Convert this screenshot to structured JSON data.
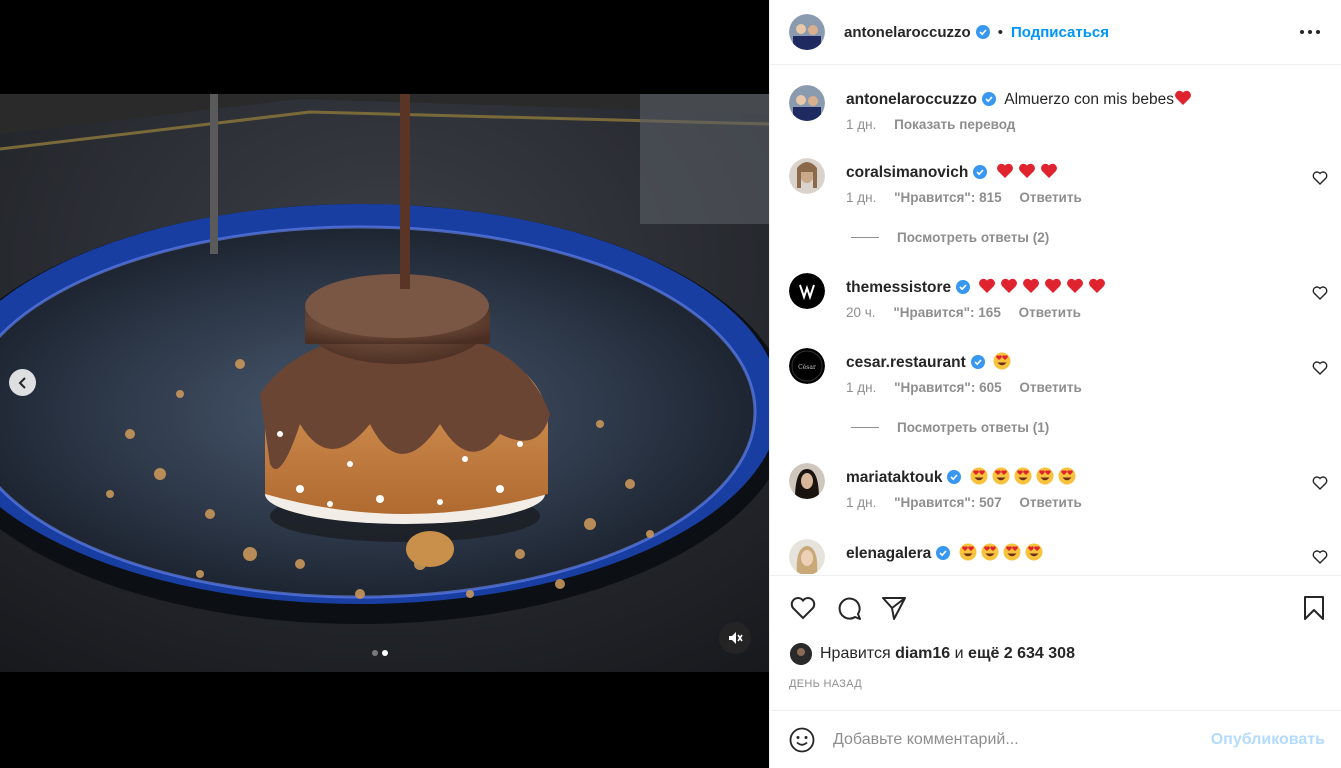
{
  "post": {
    "author": "antonelaroccuzzo",
    "follow_label": "Подписаться",
    "separator": "•",
    "caption": "Almuerzo con mis bebes",
    "caption_time": "1 дн.",
    "translate_label": "Показать перевод"
  },
  "comments": [
    {
      "user": "coralsimanovich",
      "emoji": [
        "heart",
        "heart",
        "heart"
      ],
      "time": "1 дн.",
      "likes": "\"Нравится\": 815",
      "reply": "Ответить",
      "replies_label": "Посмотреть ответы (2)"
    },
    {
      "user": "themessistore",
      "emoji": [
        "heart",
        "heart",
        "heart",
        "heart",
        "heart",
        "heart"
      ],
      "time": "20 ч.",
      "likes": "\"Нравится\": 165",
      "reply": "Ответить",
      "replies_label": ""
    },
    {
      "user": "cesar.restaurant",
      "emoji": [
        "heart-eyes"
      ],
      "time": "1 дн.",
      "likes": "\"Нравится\": 605",
      "reply": "Ответить",
      "replies_label": "Посмотреть ответы (1)"
    },
    {
      "user": "mariataktouk",
      "emoji": [
        "heart-eyes",
        "heart-eyes",
        "heart-eyes",
        "heart-eyes",
        "heart-eyes"
      ],
      "time": "1 дн.",
      "likes": "\"Нравится\": 507",
      "reply": "Ответить",
      "replies_label": ""
    },
    {
      "user": "elenagalera",
      "emoji": [
        "heart-eyes",
        "heart-eyes",
        "heart-eyes",
        "heart-eyes"
      ],
      "time": "",
      "likes": "",
      "reply": "",
      "replies_label": ""
    }
  ],
  "likes": {
    "prefix": "Нравится",
    "user": "diam16",
    "middle": "и",
    "count": "ещё 2 634 308",
    "date": "ДЕНЬ НАЗАД"
  },
  "composer": {
    "placeholder": "Добавьте комментарий...",
    "publish_label": "Опубликовать"
  },
  "carousel": {
    "slides": 2,
    "active": 2
  },
  "icons": [
    "more-icon",
    "chevron-left-icon",
    "mute-icon",
    "like-icon",
    "comment-icon",
    "share-icon",
    "save-icon",
    "emoji-icon",
    "verified-icon"
  ],
  "colors": {
    "accent": "#0095f6",
    "publish_disabled": "#b3dbff",
    "muted_text": "#8e8e8e",
    "heart": "#ed4956",
    "verified": "#3897f0"
  }
}
